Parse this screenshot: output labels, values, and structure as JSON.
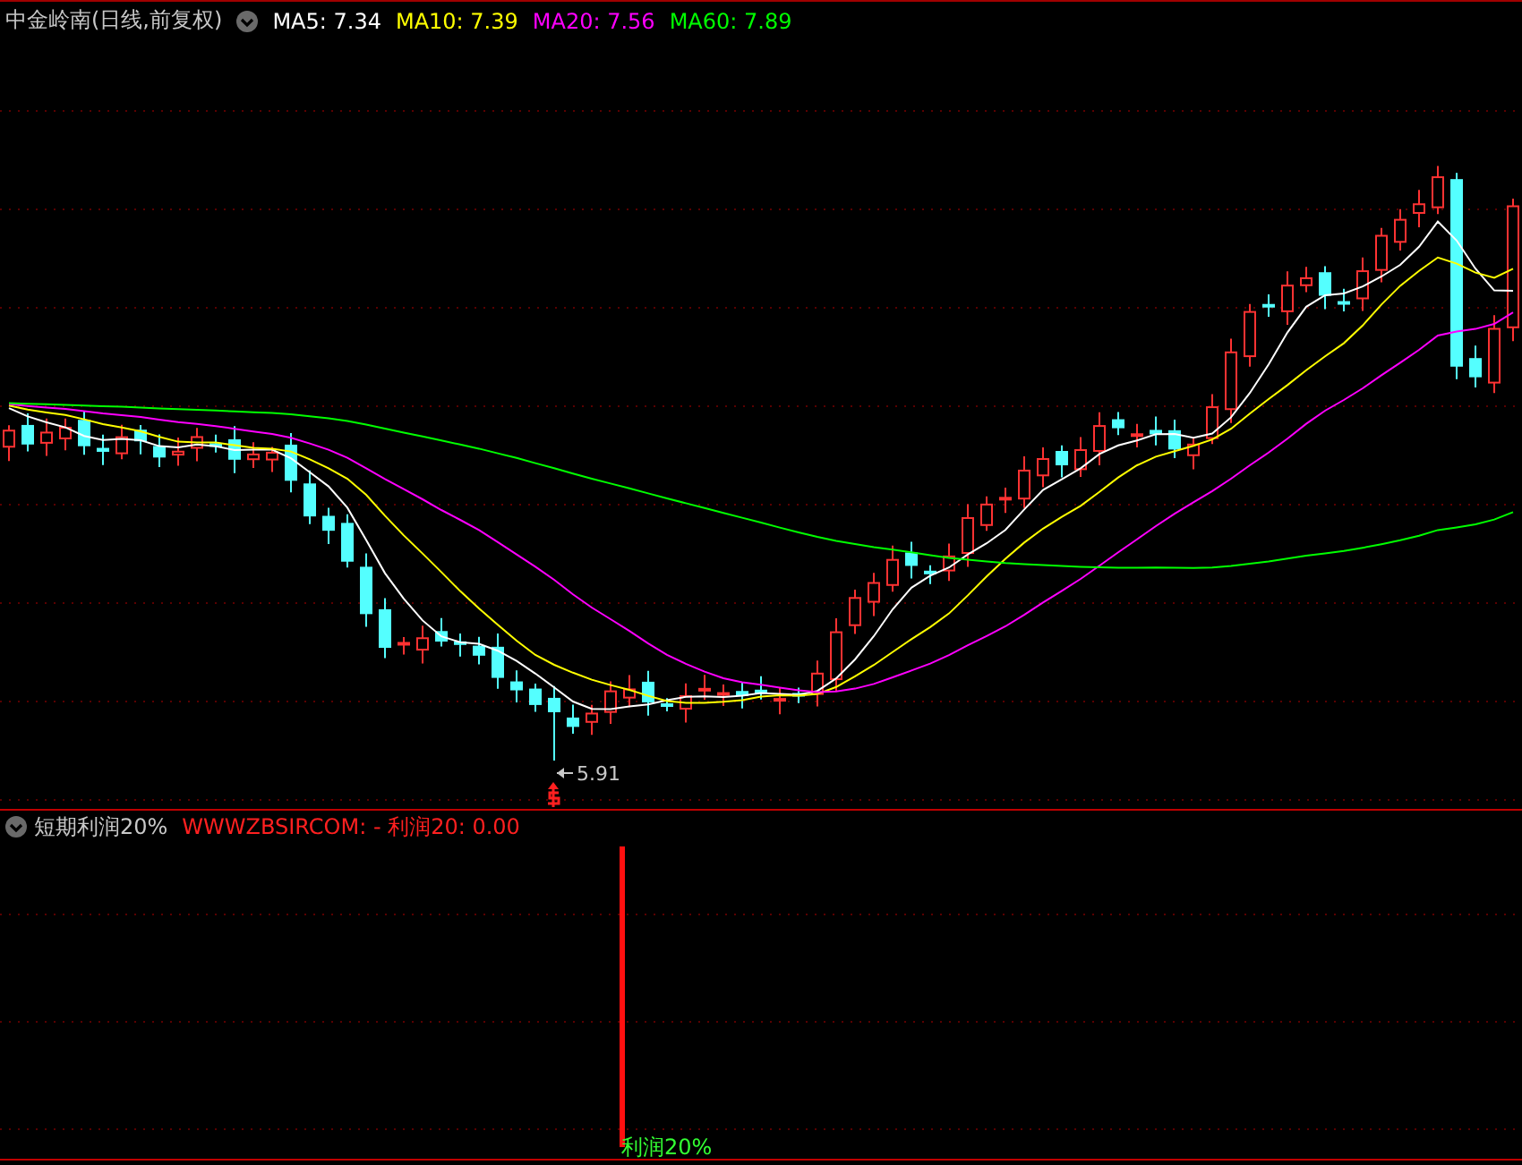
{
  "header": {
    "title": "中金岭南(日线,前复权)",
    "indicators": [
      {
        "label": "MA5: 7.34",
        "color": "#ffffff"
      },
      {
        "label": "MA10: 7.39",
        "color": "#ffff00"
      },
      {
        "label": "MA20: 7.56",
        "color": "#ff00ff"
      },
      {
        "label": "MA60: 7.89",
        "color": "#00ff00"
      }
    ]
  },
  "main_chart": {
    "low_label": "5.91"
  },
  "sub_panel": {
    "title": "短期利润20%",
    "formula": "WWWZBSIRCOM: - 利润20: 0.00",
    "signal_label": "利润20%"
  }
}
